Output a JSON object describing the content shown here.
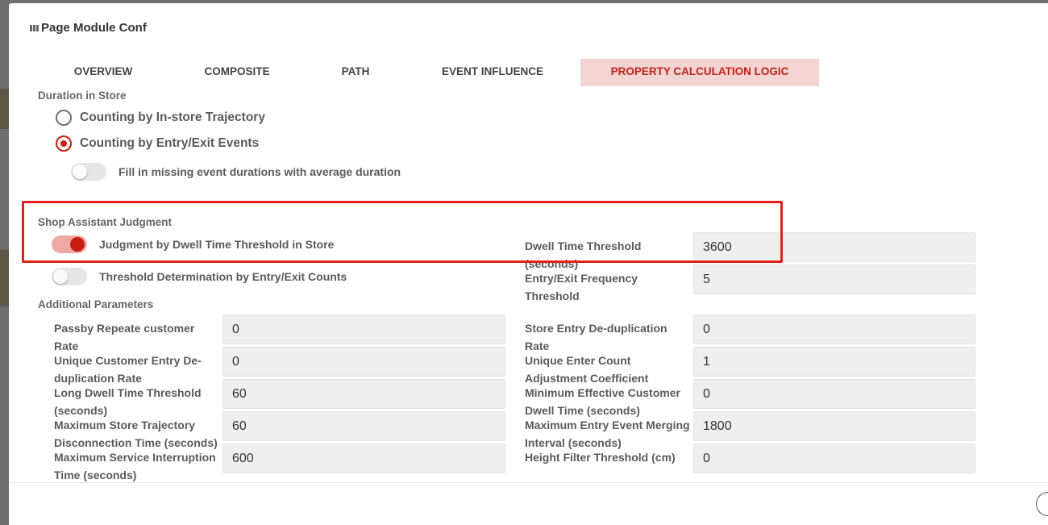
{
  "modal": {
    "title": "Page Module Conf"
  },
  "tabs": [
    {
      "label": "OVERVIEW"
    },
    {
      "label": "COMPOSITE"
    },
    {
      "label": "PATH"
    },
    {
      "label": "EVENT INFLUENCE"
    },
    {
      "label": "PROPERTY CALCULATION LOGIC",
      "active": true
    }
  ],
  "duration": {
    "label": "Duration in Store",
    "options": [
      {
        "label": "Counting by In-store Trajectory",
        "checked": false
      },
      {
        "label": "Counting by Entry/Exit Events",
        "checked": true
      }
    ],
    "fill_toggle": {
      "label": "Fill in missing event durations with average duration",
      "on": false
    }
  },
  "assistant": {
    "label": "Shop Assistant Judgment",
    "dwell_toggle": {
      "label": "Judgment by Dwell Time Threshold in Store",
      "on": true
    },
    "count_toggle": {
      "label": "Threshold Determination by Entry/Exit Counts",
      "on": false
    },
    "dwell_threshold": {
      "label_line1": "Dwell Time Threshold",
      "label_line2": "(seconds)",
      "value": "3600"
    },
    "frequency_threshold": {
      "label_line1": "Entry/Exit Frequency",
      "label_line2": "Threshold",
      "value": "5"
    }
  },
  "additional": {
    "label": "Additional Parameters",
    "left": [
      {
        "line1": "Passby Repeate customer",
        "line2": "Rate",
        "value": "0"
      },
      {
        "line1": "Unique Customer Entry De-",
        "line2": "duplication Rate",
        "value": "0"
      },
      {
        "line1": "Long Dwell Time Threshold",
        "line2": "(seconds)",
        "value": "60"
      },
      {
        "line1": "Maximum Store Trajectory",
        "line2": "Disconnection Time (seconds)",
        "value": "60"
      },
      {
        "line1": "Maximum Service Interruption",
        "line2": "Time (seconds)",
        "value": "600"
      }
    ],
    "right": [
      {
        "line1": "Store Entry De-duplication",
        "line2": "Rate",
        "value": "0"
      },
      {
        "line1": "Unique Enter Count",
        "line2": "Adjustment Coefficient",
        "value": "1"
      },
      {
        "line1": "Minimum Effective Customer",
        "line2": "Dwell Time (seconds)",
        "value": "0"
      },
      {
        "line1": "Maximum Entry Event Merging",
        "line2": "Interval (seconds)",
        "value": "1800"
      },
      {
        "line1": "Height Filter Threshold (cm)",
        "line2": "",
        "value": "0"
      }
    ]
  },
  "colors": {
    "accent": "#c81e12",
    "active_tab_bg": "#f4d4d2",
    "highlight_border": "#e32118"
  }
}
